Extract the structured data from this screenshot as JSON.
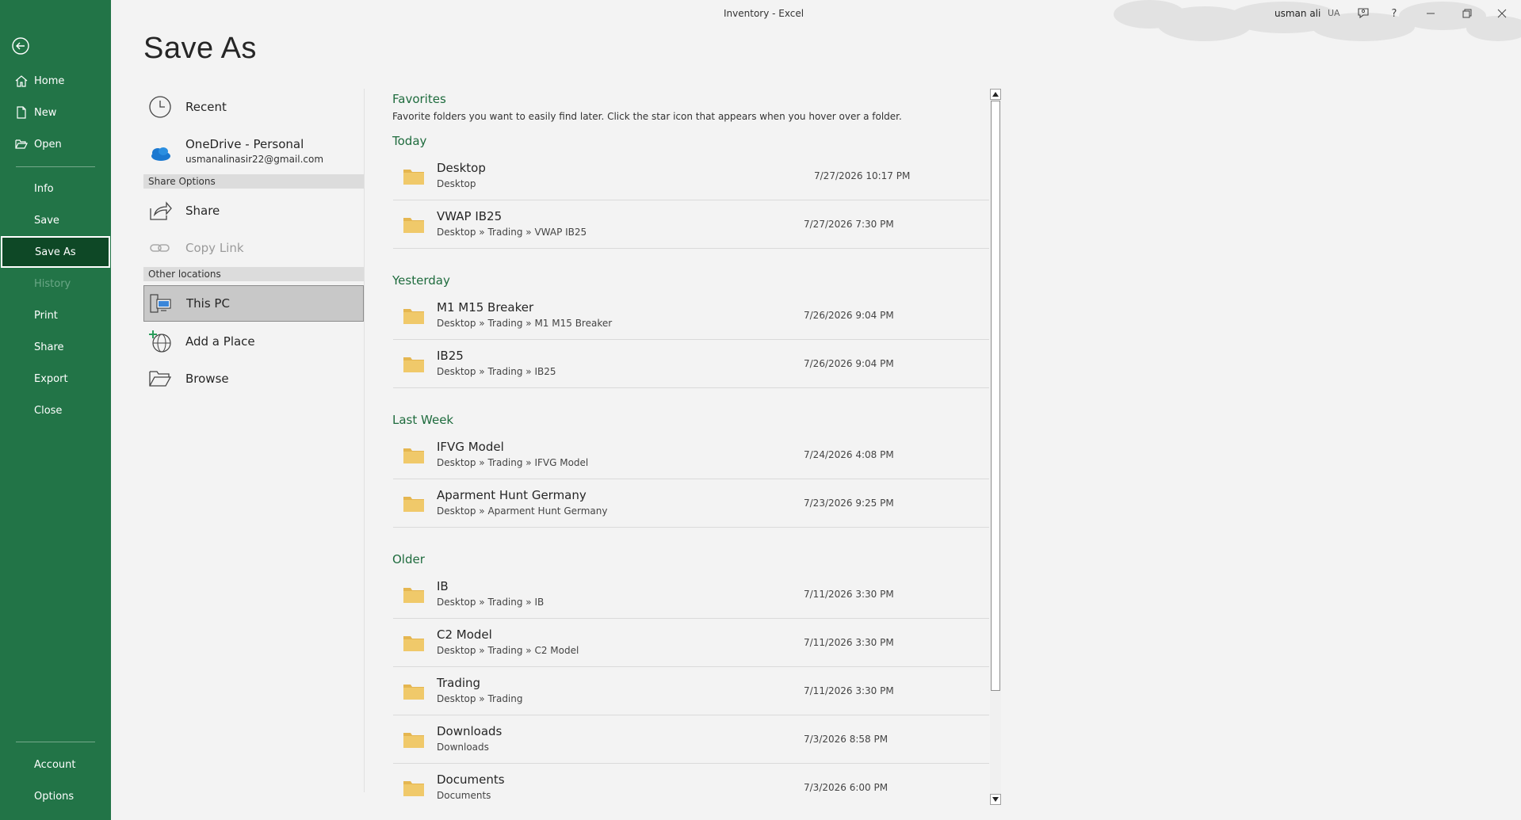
{
  "window": {
    "title": "Inventory  -  Excel",
    "user_name": "usman ali",
    "user_initials": "UA"
  },
  "nav": {
    "back_icon": "back-arrow-icon",
    "items": [
      {
        "label": "Home",
        "icon": "home-icon"
      },
      {
        "label": "New",
        "icon": "new-document-icon"
      },
      {
        "label": "Open",
        "icon": "open-folder-icon"
      },
      {
        "label": "Info"
      },
      {
        "label": "Save"
      },
      {
        "label": "Save As",
        "selected": true
      },
      {
        "label": "History",
        "disabled": true
      },
      {
        "label": "Print"
      },
      {
        "label": "Share"
      },
      {
        "label": "Export"
      },
      {
        "label": "Close"
      }
    ],
    "bottom": [
      {
        "label": "Account"
      },
      {
        "label": "Options"
      }
    ]
  },
  "page_title": "Save As",
  "locations": {
    "recent": "Recent",
    "onedrive_title": "OneDrive - Personal",
    "onedrive_email": "usmanalinasir22@gmail.com",
    "share_options_header": "Share Options",
    "share": "Share",
    "copy_link": "Copy Link",
    "other_locations_header": "Other locations",
    "this_pc": "This PC",
    "add_place": "Add a Place",
    "browse": "Browse"
  },
  "list": {
    "favorites_header": "Favorites",
    "favorites_desc": "Favorite folders you want to easily find later. Click the star icon that appears when you hover over a folder.",
    "groups": [
      {
        "header": "Today",
        "rows": [
          {
            "name": "Desktop",
            "path": "Desktop",
            "date": "7/27/2026 10:17 PM"
          },
          {
            "name": "VWAP IB25",
            "path": "Desktop » Trading » VWAP IB25",
            "date": "7/27/2026 7:30 PM"
          }
        ]
      },
      {
        "header": "Yesterday",
        "rows": [
          {
            "name": "M1 M15 Breaker",
            "path": "Desktop » Trading » M1 M15 Breaker",
            "date": "7/26/2026 9:04 PM"
          },
          {
            "name": "IB25",
            "path": "Desktop » Trading » IB25",
            "date": "7/26/2026 9:04 PM"
          }
        ]
      },
      {
        "header": "Last Week",
        "rows": [
          {
            "name": "IFVG Model",
            "path": "Desktop » Trading » IFVG Model",
            "date": "7/24/2026 4:08 PM"
          },
          {
            "name": "Aparment Hunt Germany",
            "path": "Desktop » Aparment Hunt Germany",
            "date": "7/23/2026 9:25 PM"
          }
        ]
      },
      {
        "header": "Older",
        "rows": [
          {
            "name": "IB",
            "path": "Desktop » Trading » IB",
            "date": "7/11/2026 3:30 PM"
          },
          {
            "name": "C2 Model",
            "path": "Desktop » Trading » C2 Model",
            "date": "7/11/2026 3:30 PM"
          },
          {
            "name": "Trading",
            "path": "Desktop » Trading",
            "date": "7/11/2026 3:30 PM"
          },
          {
            "name": "Downloads",
            "path": "Downloads",
            "date": "7/3/2026 8:58 PM"
          },
          {
            "name": "Documents",
            "path": "Documents",
            "date": "7/3/2026 6:00 PM"
          }
        ]
      }
    ]
  },
  "colors": {
    "nav_bg": "#227447",
    "nav_selected": "#0e4826",
    "group_header": "#1e6b3d",
    "folder": "#f0c96a"
  }
}
